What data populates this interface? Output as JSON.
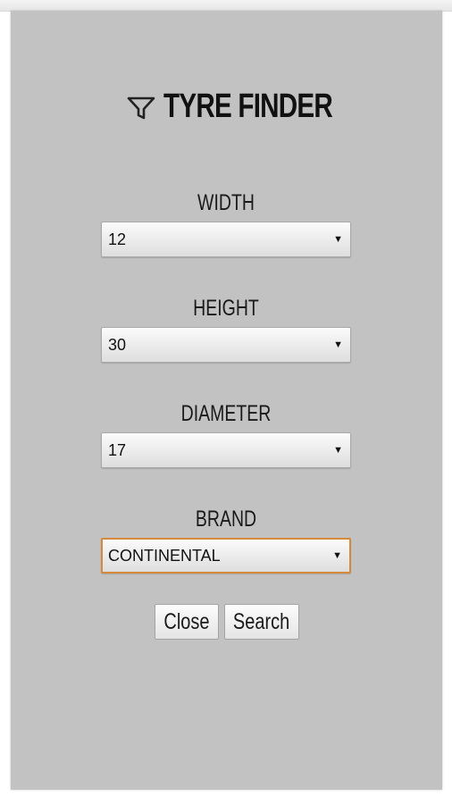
{
  "header": {
    "title": "TYRE FINDER",
    "icon": "filter-icon"
  },
  "fields": [
    {
      "label": "WIDTH",
      "value": "12"
    },
    {
      "label": "HEIGHT",
      "value": "30"
    },
    {
      "label": "DIAMETER",
      "value": "17"
    },
    {
      "label": "BRAND",
      "value": "CONTINENTAL"
    }
  ],
  "buttons": {
    "close_label": "Close",
    "search_label": "Search"
  },
  "colors": {
    "panel": "#c2c2c2",
    "focus_border": "#d48a3a"
  }
}
